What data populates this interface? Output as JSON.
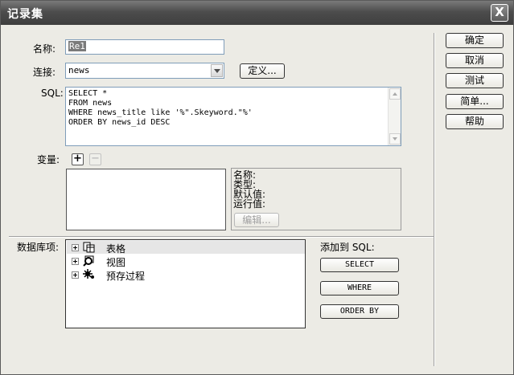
{
  "window": {
    "title": "记录集",
    "close_label": "X"
  },
  "form": {
    "name_label": "名称:",
    "name_value": "Re1",
    "connection_label": "连接:",
    "connection_value": "news",
    "define_button": "定义...",
    "sql_label": "SQL:",
    "sql_lines": [
      "SELECT *",
      "FROM news",
      "WHERE news_title like '%\".Skeyword.\"%'",
      "ORDER BY news_id DESC"
    ],
    "variables_label": "变量:",
    "add_variable": "+",
    "remove_variable": "−"
  },
  "params": {
    "name": "名称:",
    "type": "类型:",
    "default": "默认值:",
    "runtime": "运行值:",
    "edit_button": "编辑..."
  },
  "database": {
    "label": "数据库项:",
    "items": [
      {
        "label": "表格",
        "icon": "table-icon"
      },
      {
        "label": "视图",
        "icon": "view-icon"
      },
      {
        "label": "预存过程",
        "icon": "procedure-icon"
      }
    ]
  },
  "add_to_sql": {
    "label": "添加到 SQL:",
    "select": "SELECT",
    "where": "WHERE",
    "order_by": "ORDER BY"
  },
  "side_buttons": {
    "ok": "确定",
    "cancel": "取消",
    "test": "测试",
    "simple": "简单...",
    "help": "帮助"
  }
}
